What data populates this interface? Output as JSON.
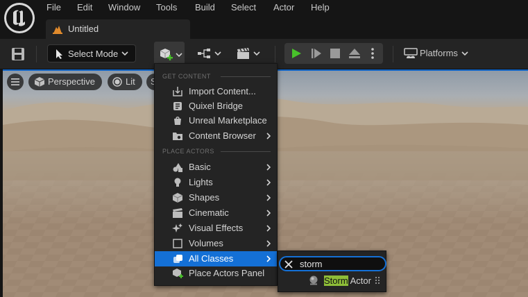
{
  "menu_bar": {
    "items": [
      "File",
      "Edit",
      "Window",
      "Tools",
      "Build",
      "Select",
      "Actor",
      "Help"
    ]
  },
  "level_tab": {
    "title": "Untitled",
    "icon": "level-icon"
  },
  "toolbar": {
    "select_mode_label": "Select Mode",
    "platforms_label": "Platforms",
    "icons": [
      "save-icon",
      "select-mode-icon",
      "add-content-icon",
      "blueprint-icon",
      "cinematics-icon",
      "play-icon",
      "advance-frame-icon",
      "stop-icon",
      "eject-icon",
      "more-options-icon",
      "platforms-icon"
    ]
  },
  "viewport": {
    "perspective_label": "Perspective",
    "lit_label": "Lit",
    "show_label": "S"
  },
  "add_menu": {
    "get_content_header": "GET CONTENT",
    "place_actors_header": "PLACE ACTORS",
    "get_content_items": [
      {
        "label": "Import Content...",
        "icon": "import-icon",
        "submenu": false
      },
      {
        "label": "Quixel Bridge",
        "icon": "bridge-icon",
        "submenu": false
      },
      {
        "label": "Unreal Marketplace",
        "icon": "marketplace-icon",
        "submenu": false
      },
      {
        "label": "Content Browser",
        "icon": "content-browser-icon",
        "submenu": true
      }
    ],
    "place_actor_items": [
      {
        "label": "Basic",
        "icon": "basic-icon",
        "submenu": true
      },
      {
        "label": "Lights",
        "icon": "light-bulb-icon",
        "submenu": true
      },
      {
        "label": "Shapes",
        "icon": "cube-icon",
        "submenu": true
      },
      {
        "label": "Cinematic",
        "icon": "clapper-icon",
        "submenu": true
      },
      {
        "label": "Visual Effects",
        "icon": "sparkle-icon",
        "submenu": true
      },
      {
        "label": "Volumes",
        "icon": "volume-icon",
        "submenu": true
      },
      {
        "label": "All Classes",
        "icon": "all-classes-icon",
        "submenu": true,
        "selected": true
      },
      {
        "label": "Place Actors Panel",
        "icon": "place-actors-icon",
        "submenu": false
      }
    ]
  },
  "sub_menu": {
    "search_value": "storm",
    "result": {
      "match": "Storm",
      "rest": " Actor",
      "icon": "actor-sphere-icon"
    }
  },
  "colors": {
    "accent": "#1470d6",
    "play_green": "#48c22a",
    "search_highlight": "#8ebd38",
    "panel_bg": "#242424",
    "menubar_bg": "#151515"
  }
}
